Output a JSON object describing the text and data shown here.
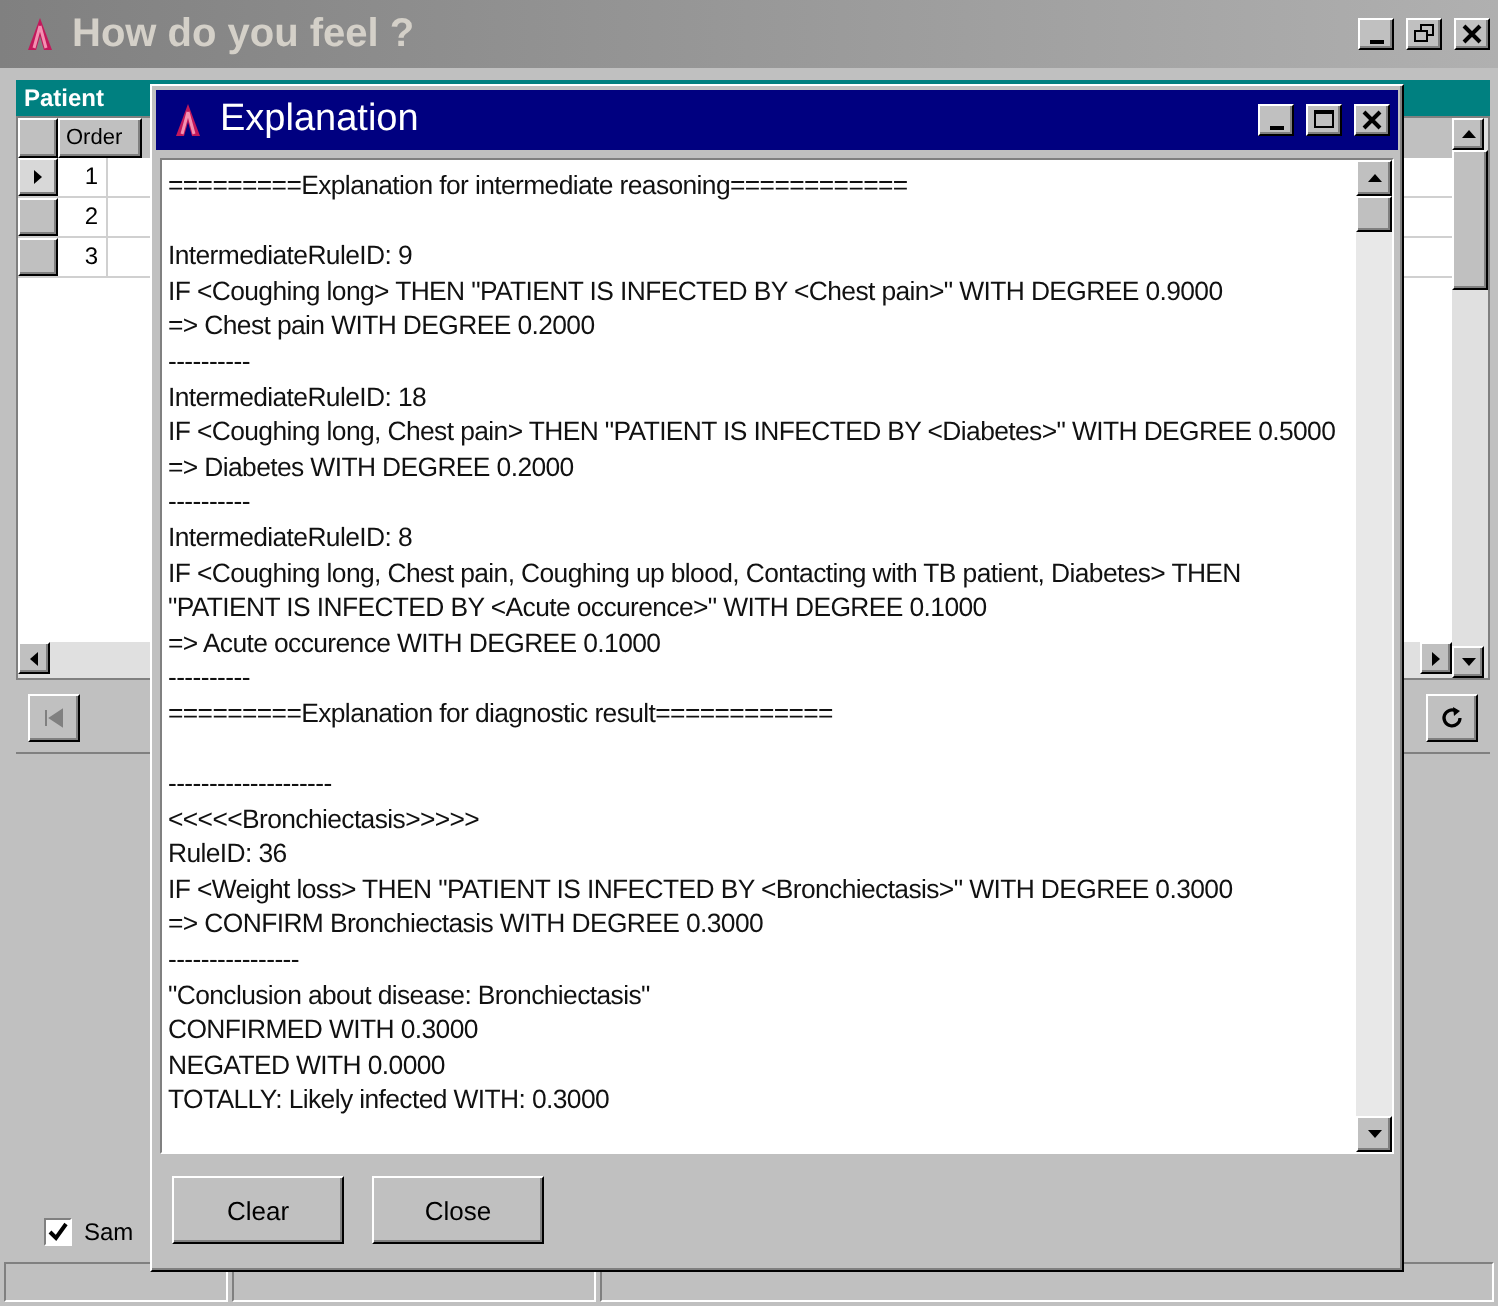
{
  "main_window": {
    "title": "How do you feel ?",
    "active": false,
    "panel": {
      "title": "Patient",
      "grid": {
        "columns": [
          "Order"
        ],
        "rows": [
          {
            "order": "1",
            "selected": true
          },
          {
            "order": "2",
            "selected": false
          },
          {
            "order": "3",
            "selected": false
          }
        ]
      }
    },
    "checkbox": {
      "label": "Sam",
      "checked": true
    }
  },
  "dialog": {
    "title": "Explanation",
    "active": true,
    "lines": [
      {
        "kind": "text",
        "text": "=========Explanation for intermediate reasoning============"
      },
      {
        "kind": "blank"
      },
      {
        "kind": "text",
        "text": "IntermediateRuleID: 9"
      },
      {
        "kind": "text",
        "text": "IF <Coughing long> THEN \"PATIENT IS INFECTED BY <Chest pain>\" WITH DEGREE 0.9000"
      },
      {
        "kind": "text",
        "text": "=> Chest pain WITH DEGREE 0.2000"
      },
      {
        "kind": "text",
        "text": "----------"
      },
      {
        "kind": "text",
        "text": "IntermediateRuleID: 18"
      },
      {
        "kind": "text",
        "text": "IF <Coughing long, Chest pain> THEN \"PATIENT IS INFECTED BY <Diabetes>\" WITH DEGREE 0.5000"
      },
      {
        "kind": "text",
        "text": "=> Diabetes WITH DEGREE 0.2000"
      },
      {
        "kind": "text",
        "text": "----------"
      },
      {
        "kind": "text",
        "text": "IntermediateRuleID: 8"
      },
      {
        "kind": "text",
        "text": "IF <Coughing long, Chest pain, Coughing up blood, Contacting with TB patient, Diabetes> THEN"
      },
      {
        "kind": "text",
        "text": "\"PATIENT IS INFECTED BY <Acute occurence>\" WITH DEGREE 0.1000"
      },
      {
        "kind": "text",
        "text": "=> Acute occurence WITH DEGREE 0.1000"
      },
      {
        "kind": "text",
        "text": "----------"
      },
      {
        "kind": "text",
        "text": "=========Explanation for diagnostic result============"
      },
      {
        "kind": "blank"
      },
      {
        "kind": "text",
        "text": "--------------------"
      },
      {
        "kind": "text",
        "text": "<<<<<Bronchiectasis>>>>>"
      },
      {
        "kind": "text",
        "text": "RuleID: 36"
      },
      {
        "kind": "text",
        "text": "IF <Weight loss> THEN \"PATIENT IS INFECTED BY <Bronchiectasis>\" WITH DEGREE 0.3000"
      },
      {
        "kind": "text",
        "text": "=> CONFIRM Bronchiectasis WITH DEGREE 0.3000"
      },
      {
        "kind": "text",
        "text": "----------------"
      },
      {
        "kind": "text",
        "text": "\"Conclusion about disease: Bronchiectasis\""
      },
      {
        "kind": "text",
        "text": "CONFIRMED WITH 0.3000"
      },
      {
        "kind": "text",
        "text": "NEGATED WITH 0.0000"
      },
      {
        "kind": "text",
        "text": "TOTALLY: Likely infected WITH: 0.3000"
      }
    ],
    "buttons": [
      "Clear",
      "Close"
    ]
  }
}
